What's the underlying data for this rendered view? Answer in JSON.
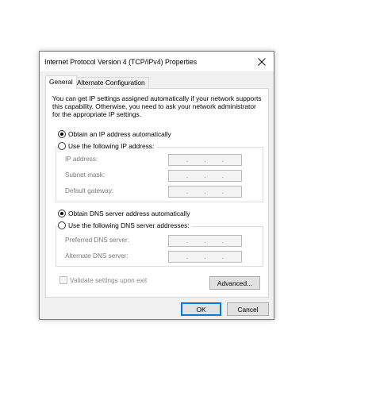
{
  "dialog": {
    "title": "Internet Protocol Version 4 (TCP/IPv4) Properties",
    "close_icon": "close-icon"
  },
  "tabs": [
    {
      "label": "General",
      "selected": true
    },
    {
      "label": "Alternate Configuration",
      "selected": false
    }
  ],
  "intro": [
    "You can get IP settings assigned automatically if your network supports",
    "this capability. Otherwise, you need to ask your network administrator",
    "for the appropriate IP settings."
  ],
  "ip": {
    "auto_label": "Obtain an IP address automatically",
    "auto_selected": true,
    "manual_label": "Use the following IP address:",
    "manual_selected": false,
    "fields": [
      {
        "label": "IP address:",
        "value": ".   .   ."
      },
      {
        "label": "Subnet mask:",
        "value": ".   .   ."
      },
      {
        "label": "Default gateway:",
        "value": ".   .   ."
      }
    ]
  },
  "dns": {
    "auto_label": "Obtain DNS server address automatically",
    "auto_selected": true,
    "manual_label": "Use the following DNS server addresses:",
    "manual_selected": false,
    "fields": [
      {
        "label": "Preferred DNS server:",
        "value": ".   .   ."
      },
      {
        "label": "Alternate DNS server:",
        "value": ".   .   ."
      }
    ]
  },
  "validate": {
    "label": "Validate settings upon exit",
    "checked": false,
    "enabled": false
  },
  "buttons": {
    "advanced": "Advanced...",
    "ok": "OK",
    "cancel": "Cancel"
  }
}
